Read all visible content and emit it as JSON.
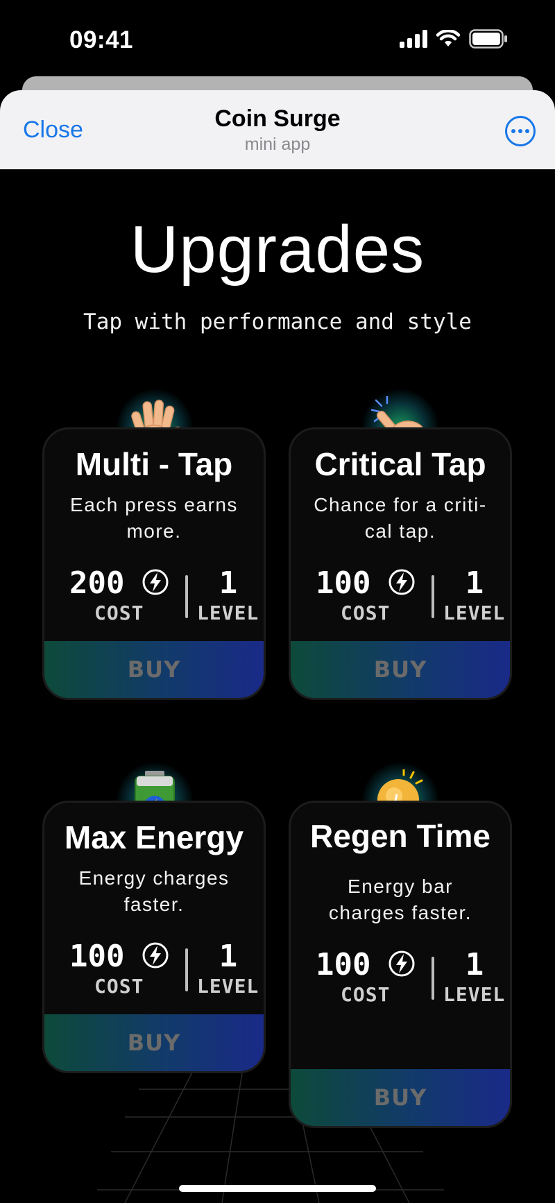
{
  "status_bar": {
    "time": "09:41"
  },
  "header": {
    "close_label": "Close",
    "title": "Coin Surge",
    "subtitle": "mini app"
  },
  "main": {
    "title": "Upgrades",
    "subtitle": "Tap with performance and style"
  },
  "cards": [
    {
      "icon": "open-hand-icon",
      "title": "Multi - Tap",
      "description": "Each press earns more.",
      "cost": "200",
      "cost_label": "COST",
      "level": "1",
      "level_label": "LEVEL",
      "buy_label": "BUY"
    },
    {
      "icon": "pointing-finger-icon",
      "title": "Critical Tap",
      "description": "Chance for a criti-cal tap.",
      "cost": "100",
      "cost_label": "COST",
      "level": "1",
      "level_label": "LEVEL",
      "buy_label": "BUY"
    },
    {
      "icon": "battery-icon",
      "title": "Max Energy",
      "description": "Energy charges faster.",
      "cost": "100",
      "cost_label": "COST",
      "level": "1",
      "level_label": "LEVEL",
      "buy_label": "BUY"
    },
    {
      "icon": "lightbulb-icon",
      "title": "Regen Time",
      "description": "Energy bar charges faster.",
      "cost": "100",
      "cost_label": "COST",
      "level": "1",
      "level_label": "LEVEL",
      "buy_label": "BUY"
    }
  ],
  "colors": {
    "accent": "#1877e8",
    "buy_gradient_start": "#0d4a3a",
    "buy_gradient_end": "#1a2a88",
    "glow": "#1ec878"
  }
}
